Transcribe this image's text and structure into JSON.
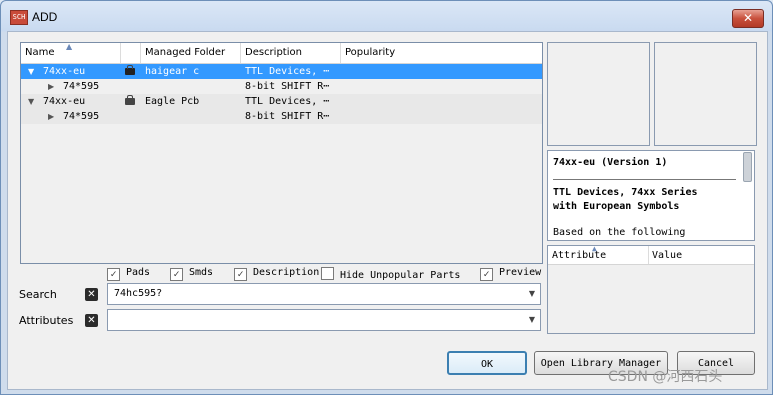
{
  "window": {
    "title": "ADD",
    "app_icon": "SCH",
    "close_label": "✕"
  },
  "tree": {
    "columns": [
      "Name",
      "",
      "Managed Folder",
      "Description",
      "Popularity"
    ],
    "rows": [
      {
        "name": "74xx-eu",
        "expanded": true,
        "folder": "haigear c",
        "description": "TTL Devices, ⋯",
        "selected": true,
        "level": 0
      },
      {
        "name": "74*595",
        "expanded": false,
        "folder": "",
        "description": "8-bit SHIFT R⋯",
        "selected": false,
        "level": 1
      },
      {
        "name": "74xx-eu",
        "expanded": true,
        "folder": "Eagle Pcb",
        "description": "TTL Devices, ⋯",
        "selected": false,
        "level": 0
      },
      {
        "name": "74*595",
        "expanded": false,
        "folder": "",
        "description": "8-bit SHIFT R⋯",
        "selected": false,
        "level": 1
      }
    ]
  },
  "description_panel": {
    "title": "74xx-eu (Version 1)",
    "body_line1": "TTL Devices, 74xx Series",
    "body_line2": "with European Symbols",
    "body_line3": "Based on the following"
  },
  "attributes_table": {
    "columns": [
      "Attribute",
      "Value"
    ]
  },
  "filters": [
    {
      "label": "Pads",
      "checked": true
    },
    {
      "label": "Smds",
      "checked": true
    },
    {
      "label": "Description",
      "checked": true
    },
    {
      "label": "Hide Unpopular Parts",
      "checked": false
    },
    {
      "label": "Preview",
      "checked": true
    }
  ],
  "search": {
    "label": "Search",
    "value": "74hc595?"
  },
  "attributes": {
    "label": "Attributes",
    "value": ""
  },
  "buttons": {
    "ok": "OK",
    "open_library_manager": "Open Library Manager",
    "cancel": "Cancel"
  },
  "watermark": "CSDN @河西石头"
}
